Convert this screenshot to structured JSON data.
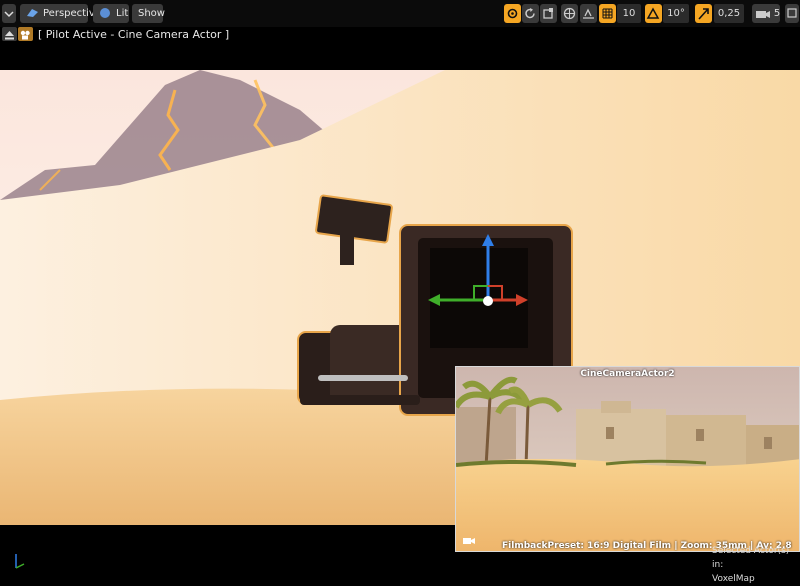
{
  "toolbar": {
    "perspective_label": "Perspective",
    "lit_label": "Lit",
    "show_label": "Show",
    "grid_snap_value": "10",
    "rotation_snap_value": "10°",
    "scale_snap_value": "0,25",
    "camera_speed_value": "5"
  },
  "pilot": {
    "label": "[ Pilot Active - Cine Camera Actor ]"
  },
  "preview": {
    "title": "CineCameraActor2",
    "info": "FilmbackPreset: 16:9 Digital Film | Zoom: 35mm | Av: 2.8"
  },
  "status": {
    "selected_actor": "Selected Actor(s) in:",
    "level": "VoxelMap"
  },
  "colors": {
    "accent": "#f5a623",
    "axis_x": "#d0402a",
    "axis_y": "#3fae2a",
    "axis_z": "#2f7ee8"
  }
}
